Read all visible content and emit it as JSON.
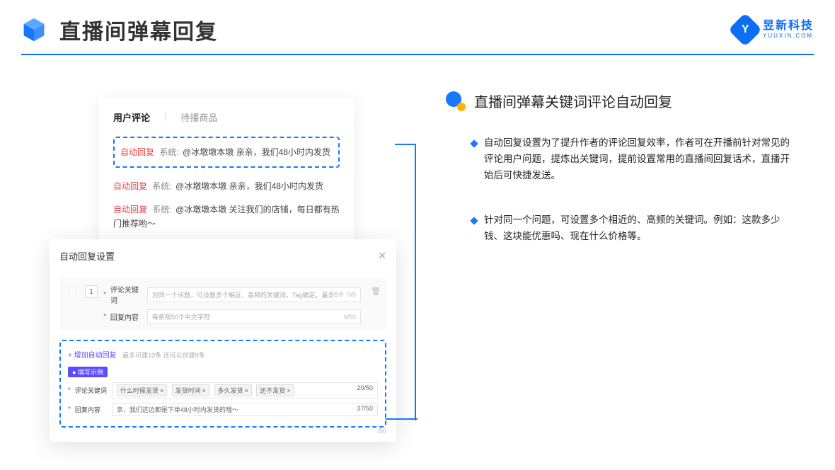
{
  "header": {
    "title": "直播间弹幕回复",
    "brand_name": "昱新科技",
    "brand_sub": "YUUXIN.COM"
  },
  "comments": {
    "tab_active": "用户评论",
    "tab_inactive": "待播商品",
    "row1_badge": "自动回复",
    "row1_sys": "系统:",
    "row1_text": "@冰墩墩本墩 亲亲，我们48小时内发货",
    "row2_badge": "自动回复",
    "row2_sys": "系统:",
    "row2_text": "@冰墩墩本墩 亲亲，我们48小时内发货",
    "row3_badge": "自动回复",
    "row3_sys": "系统:",
    "row3_text": "@冰墩墩本墩 关注我们的店铺，每日都有热门推荐哟～"
  },
  "settings": {
    "panel_title": "自动回复设置",
    "index": "1",
    "kw_label": "评论关键词",
    "kw_placeholder": "对同一个问题，可设置多个相近、高频的关键词，Tag确定，最多5个",
    "kw_counter": "0/5",
    "content_label": "回复内容",
    "content_placeholder": "每条限50个中文字符",
    "content_counter": "0/50",
    "add_link": "+ 增加自动回复",
    "add_hint": "最多可建10条 还可以创建9条",
    "example_badge": "● 填写示例",
    "ex_kw_label": "评论关键词",
    "ex_tag1": "什么时候发货",
    "ex_tag2": "发货时间",
    "ex_tag3": "多久发货",
    "ex_tag4": "还不发货",
    "ex_kw_counter": "20/50",
    "ex_content_label": "回复内容",
    "ex_content_text": "亲，我们这边都是下单48小时内发货的哦～",
    "ex_content_counter": "37/50",
    "bottom_counter": "/50"
  },
  "right": {
    "subtitle": "直播间弹幕关键词评论自动回复",
    "bullet1": "自动回复设置为了提升作者的评论回复效率，作者可在开播前针对常见的评论用户问题，提炼出关键词，提前设置常用的直播间回复话术，直播开始后可快捷发送。",
    "bullet2": "针对同一个问题，可设置多个相近的、高频的关键词。例如：这款多少钱、这块能优惠吗、现在什么价格等。"
  }
}
